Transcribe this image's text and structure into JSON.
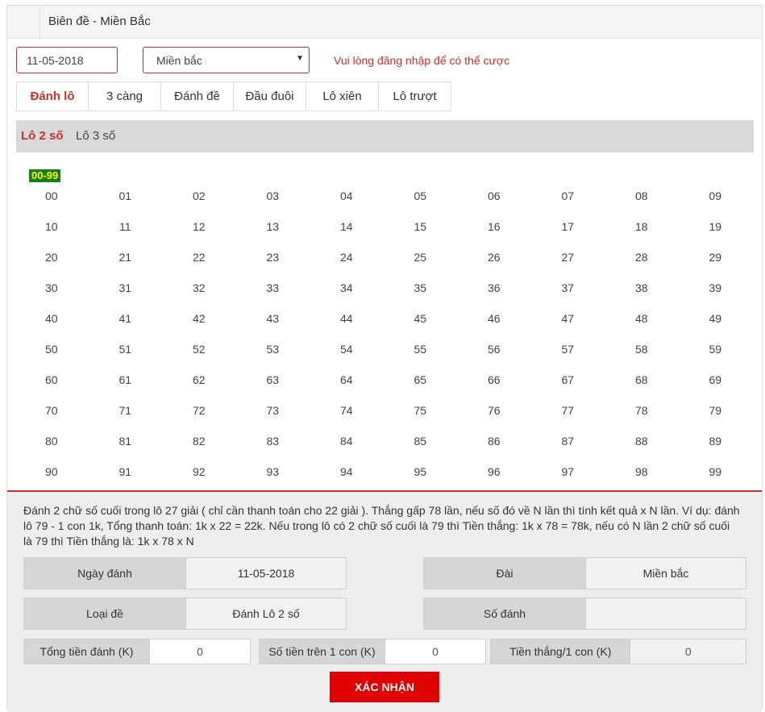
{
  "header": {
    "title": "Biên đề - Miền Bắc"
  },
  "filters": {
    "date": "11-05-2018",
    "region": "Miền bắc",
    "login_note": "Vui lòng đăng nhập để có thể cược"
  },
  "tabs": [
    {
      "label": "Đánh lô",
      "active": true
    },
    {
      "label": "3 càng"
    },
    {
      "label": "Đánh đề"
    },
    {
      "label": "Đầu đuôi"
    },
    {
      "label": "Lô xiên"
    },
    {
      "label": "Lô trượt"
    }
  ],
  "subtabs": [
    {
      "label": "Lô 2 số",
      "active": true
    },
    {
      "label": "Lô 3 số"
    }
  ],
  "range_label": "00-99",
  "numbers": [
    "00",
    "01",
    "02",
    "03",
    "04",
    "05",
    "06",
    "07",
    "08",
    "09",
    "10",
    "11",
    "12",
    "13",
    "14",
    "15",
    "16",
    "17",
    "18",
    "19",
    "20",
    "21",
    "22",
    "23",
    "24",
    "25",
    "26",
    "27",
    "28",
    "29",
    "30",
    "31",
    "32",
    "33",
    "34",
    "35",
    "36",
    "37",
    "38",
    "39",
    "40",
    "41",
    "42",
    "43",
    "44",
    "45",
    "46",
    "47",
    "48",
    "49",
    "50",
    "51",
    "52",
    "53",
    "54",
    "55",
    "56",
    "57",
    "58",
    "59",
    "60",
    "61",
    "62",
    "63",
    "64",
    "65",
    "66",
    "67",
    "68",
    "69",
    "70",
    "71",
    "72",
    "73",
    "74",
    "75",
    "76",
    "77",
    "78",
    "79",
    "80",
    "81",
    "82",
    "83",
    "84",
    "85",
    "86",
    "87",
    "88",
    "89",
    "90",
    "91",
    "92",
    "93",
    "94",
    "95",
    "96",
    "97",
    "98",
    "99"
  ],
  "description": "Đánh 2 chữ số cuối trong lô 27 giải ( chỉ cần thanh toán cho 22 giải ). Thắng gấp 78 lần, nếu số đó về N lần thì tính kết quả x N lần. Ví dụ: đánh lô 79 - 1 con 1k, Tổng thanh toán: 1k x 22 = 22k. Nếu trong lô có 2 chữ số cuối là 79 thì Tiền thắng: 1k x 78 = 78k, nếu có N lần 2 chữ số cuối là 79 thì Tiền thắng là: 1k x 78 x N",
  "summary": {
    "date_label": "Ngày đánh",
    "date_value": "11-05-2018",
    "station_label": "Đài",
    "station_value": "Miền bắc",
    "type_label": "Loại đề",
    "type_value": "Đánh Lô 2 số",
    "numbers_label": "Số đánh",
    "numbers_value": ""
  },
  "money": {
    "total_label": "Tổng tiền đánh (K)",
    "total_value": "0",
    "per_label": "Số tiền trên 1 con (K)",
    "per_value": "0",
    "win_label": "Tiền thắng/1 con (K)",
    "win_value": "0"
  },
  "confirm_label": "XÁC NHẬN",
  "colors": {
    "accent": "#c9302c",
    "button": "#e00000",
    "badge_bg": "#1a7d20",
    "badge_fg": "#fff200"
  }
}
